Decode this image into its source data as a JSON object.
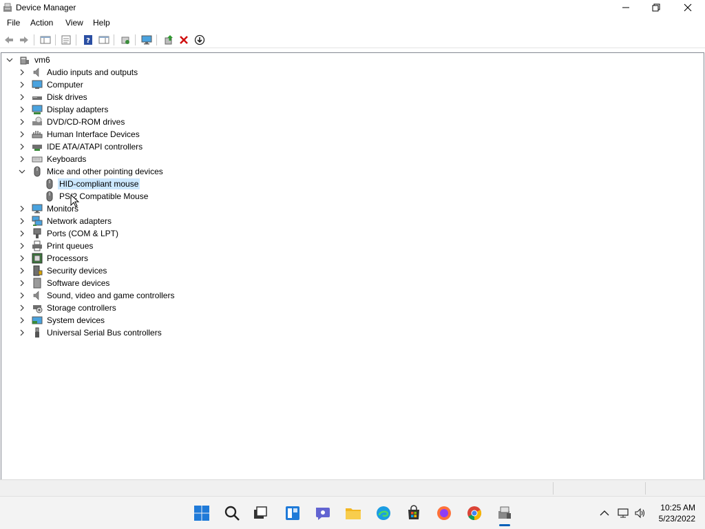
{
  "window": {
    "title": "Device Manager"
  },
  "menu": [
    "File",
    "Action",
    "View",
    "Help"
  ],
  "tree": {
    "root": "vm6",
    "categories": [
      {
        "label": "Audio inputs and outputs",
        "icon": "speaker-icon",
        "expanded": false
      },
      {
        "label": "Computer",
        "icon": "computer-icon",
        "expanded": false
      },
      {
        "label": "Disk drives",
        "icon": "disk-drive-icon",
        "expanded": false
      },
      {
        "label": "Display adapters",
        "icon": "display-adapter-icon",
        "expanded": false
      },
      {
        "label": "DVD/CD-ROM drives",
        "icon": "dvd-drive-icon",
        "expanded": false
      },
      {
        "label": "Human Interface Devices",
        "icon": "hid-icon",
        "expanded": false
      },
      {
        "label": "IDE ATA/ATAPI controllers",
        "icon": "ide-controller-icon",
        "expanded": false
      },
      {
        "label": "Keyboards",
        "icon": "keyboard-icon",
        "expanded": false
      },
      {
        "label": "Mice and other pointing devices",
        "icon": "mouse-icon",
        "expanded": true,
        "children": [
          {
            "label": "HID-compliant mouse",
            "icon": "mouse-icon",
            "selected": true
          },
          {
            "label": "PS/2 Compatible Mouse",
            "icon": "mouse-icon",
            "selected": false
          }
        ]
      },
      {
        "label": "Monitors",
        "icon": "monitor-icon",
        "expanded": false
      },
      {
        "label": "Network adapters",
        "icon": "network-adapter-icon",
        "expanded": false
      },
      {
        "label": "Ports (COM & LPT)",
        "icon": "port-icon",
        "expanded": false
      },
      {
        "label": "Print queues",
        "icon": "printer-icon",
        "expanded": false
      },
      {
        "label": "Processors",
        "icon": "processor-icon",
        "expanded": false
      },
      {
        "label": "Security devices",
        "icon": "security-device-icon",
        "expanded": false
      },
      {
        "label": "Software devices",
        "icon": "software-device-icon",
        "expanded": false
      },
      {
        "label": "Sound, video and game controllers",
        "icon": "speaker-icon",
        "expanded": false
      },
      {
        "label": "Storage controllers",
        "icon": "storage-controller-icon",
        "expanded": false
      },
      {
        "label": "System devices",
        "icon": "system-devices-icon",
        "expanded": false
      },
      {
        "label": "Universal Serial Bus controllers",
        "icon": "usb-icon",
        "expanded": false
      }
    ]
  },
  "taskbar": {
    "apps": [
      "start-icon",
      "search-icon",
      "task-view-icon",
      "widgets-icon",
      "chat-icon",
      "file-explorer-icon",
      "edge-icon",
      "store-icon",
      "firefox-icon",
      "chrome-icon",
      "device-manager-icon"
    ],
    "active_app": "device-manager-icon"
  },
  "clock": {
    "time": "10:25 AM",
    "date": "5/23/2022"
  },
  "colors": {
    "selection": "#cce8ff",
    "accent": "#005fb8"
  }
}
